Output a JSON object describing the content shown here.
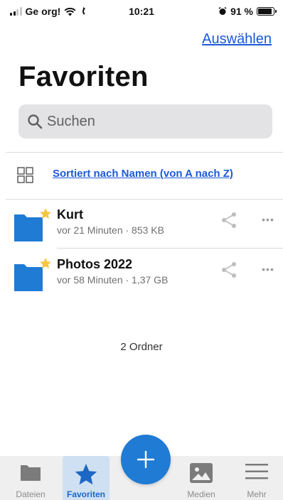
{
  "status_bar": {
    "carrier": "Ge org!",
    "time": "10:21",
    "battery_percent": "91 %",
    "battery_level": 0.91
  },
  "header": {
    "select_label": "Auswählen",
    "title": "Favoriten"
  },
  "search": {
    "placeholder": "Suchen"
  },
  "sort": {
    "label": "Sortiert nach Namen (von A nach Z)"
  },
  "items": [
    {
      "name": "Kurt",
      "meta": "vor 21 Minuten · 853 KB",
      "favorite": true
    },
    {
      "name": "Photos 2022",
      "meta": "vor 58 Minuten · 1,37 GB",
      "favorite": true
    }
  ],
  "folder_count": "2 Ordner",
  "tabs": [
    {
      "label": "Dateien",
      "icon": "folder-icon",
      "active": false
    },
    {
      "label": "Favoriten",
      "icon": "star-icon",
      "active": true
    },
    {
      "label": "Medien",
      "icon": "image-icon",
      "active": false
    },
    {
      "label": "Mehr",
      "icon": "menu-icon",
      "active": false
    }
  ],
  "colors": {
    "accent": "#1b59d9",
    "folder": "#1f7bd4",
    "star": "#f5c542",
    "active_tab_bg": "#cfe0f2"
  }
}
